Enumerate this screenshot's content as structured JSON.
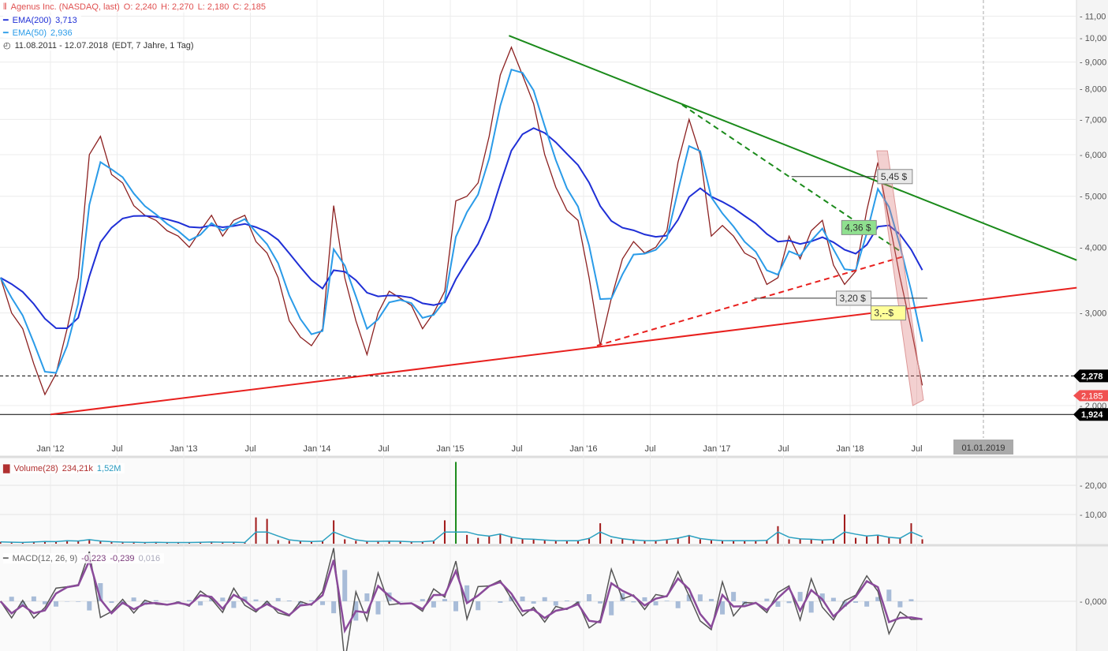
{
  "header": {
    "instrument": "Agenus Inc. (NASDAQ, last)",
    "ohlc": {
      "open": "O: 2,240",
      "high": "H: 2,270",
      "low": "L: 2,180",
      "close": "C: 2,185"
    },
    "ema200": {
      "label": "EMA(200)",
      "value": "3,713",
      "color": "#1f2fd6"
    },
    "ema50": {
      "label": "EMA(50)",
      "value": "2,936",
      "color": "#2a9be8"
    },
    "range": "11.08.2011 - 12.07.2018",
    "range_info": "(EDT, 7 Jahre, 1 Tag)"
  },
  "volume_legend": {
    "label": "Volume(28)",
    "value": "234,21k",
    "avg": "1,52M"
  },
  "macd_legend": {
    "label": "MACD(12, 26, 9)",
    "macd": "-0,223",
    "signal": "-0,239",
    "hist": "0,016"
  },
  "chart_data": {
    "type": "line",
    "scale": "log",
    "grid": true,
    "price_ticks": [
      "11,00",
      "10,00",
      "9,000",
      "8,000",
      "7,000",
      "6,000",
      "5,000",
      "4,000",
      "3,000",
      "2,000"
    ],
    "price_tick_values": [
      11,
      10,
      9,
      8,
      7,
      6,
      5,
      4,
      3,
      2
    ],
    "x_ticks": [
      {
        "label": "Jan '12",
        "date": 2012.0
      },
      {
        "label": "Jul",
        "date": 2012.5
      },
      {
        "label": "Jan '13",
        "date": 2013.0
      },
      {
        "label": "Jul",
        "date": 2013.5
      },
      {
        "label": "Jan '14",
        "date": 2014.0
      },
      {
        "label": "Jul",
        "date": 2014.5
      },
      {
        "label": "Jan '15",
        "date": 2015.0
      },
      {
        "label": "Jul",
        "date": 2015.5
      },
      {
        "label": "Jan '16",
        "date": 2016.0
      },
      {
        "label": "Jul",
        "date": 2016.5
      },
      {
        "label": "Jan '17",
        "date": 2017.0
      },
      {
        "label": "Jul",
        "date": 2017.5
      },
      {
        "label": "Jan '18",
        "date": 2018.0
      },
      {
        "label": "Jul",
        "date": 2018.5
      }
    ],
    "cursor_date": {
      "label": "01.01.2019",
      "date": 2019.0
    },
    "price": {
      "start": "2011-08",
      "values": [
        3.5,
        3.0,
        2.8,
        2.4,
        2.1,
        2.3,
        2.8,
        3.5,
        6.0,
        6.5,
        5.5,
        5.3,
        4.8,
        4.6,
        4.5,
        4.3,
        4.2,
        4.0,
        4.3,
        4.6,
        4.2,
        4.5,
        4.6,
        4.1,
        3.9,
        3.5,
        2.9,
        2.7,
        2.6,
        2.8,
        4.8,
        3.5,
        2.9,
        2.5,
        3.0,
        3.3,
        3.2,
        3.1,
        2.8,
        3.0,
        3.3,
        4.9,
        5.0,
        5.3,
        6.5,
        8.5,
        9.6,
        8.5,
        7.5,
        6.0,
        5.2,
        4.7,
        4.5,
        3.5,
        2.6,
        3.2,
        3.8,
        4.1,
        3.9,
        4.0,
        4.3,
        5.8,
        7.0,
        6.0,
        4.2,
        4.4,
        4.2,
        3.9,
        3.8,
        3.4,
        3.5,
        4.2,
        3.8,
        4.3,
        4.5,
        3.7,
        3.4,
        3.6,
        4.7,
        5.8,
        4.5,
        3.5,
        2.8,
        2.185
      ]
    },
    "trendlines": [
      {
        "color": "#1a8a1a",
        "style": "solid",
        "from": [
          2015.44,
          10.1
        ],
        "to": [
          2019.7,
          3.78
        ]
      },
      {
        "color": "#1a8a1a",
        "style": "dashed",
        "from": [
          2016.74,
          7.46
        ],
        "to": [
          2018.37,
          3.94
        ]
      },
      {
        "color": "#e8201e",
        "style": "solid",
        "from": [
          2012.0,
          1.924
        ],
        "to": [
          2019.7,
          3.35
        ]
      },
      {
        "color": "#e8201e",
        "style": "dashed",
        "from": [
          2016.1,
          2.6
        ],
        "to": [
          2018.4,
          3.84
        ]
      }
    ],
    "horizontal_levels": [
      {
        "value": 2.278,
        "label": "2,278",
        "style": "dashed"
      },
      {
        "value": 1.924,
        "label": "1,924",
        "style": "solid"
      }
    ],
    "last_price": {
      "value": 2.185,
      "label": "2,185",
      "color": "#f05050"
    },
    "annotations": [
      {
        "label": "5,45 $",
        "date": 2018.23,
        "value": 5.45,
        "bg": "#e8e8e8",
        "from": 2017.56,
        "to": 2018.2
      },
      {
        "label": "4,36 $",
        "date": 2017.96,
        "value": 4.36,
        "bg": "#8fe08f"
      },
      {
        "label": "3,20 $",
        "date": 2017.92,
        "value": 3.2,
        "bg": "#e8e8e8",
        "from": 2017.28,
        "to": 2018.58
      },
      {
        "label": "3,--$",
        "date": 2018.18,
        "value": 3.0,
        "bg": "#ffff99"
      }
    ],
    "volume": {
      "ticks": [
        "20,00",
        "10,00"
      ],
      "tick_values": [
        20,
        10
      ],
      "start": "2011-08",
      "values": [
        0.6,
        0.5,
        0.4,
        0.6,
        0.8,
        0.7,
        1.1,
        0.9,
        1.5,
        0.8,
        0.6,
        0.5,
        0.5,
        0.4,
        0.5,
        0.4,
        0.4,
        0.4,
        0.5,
        0.6,
        0.5,
        0.5,
        0.4,
        9,
        8.5,
        1.2,
        1.0,
        0.8,
        0.7,
        0.9,
        8.0,
        1.5,
        1.0,
        0.7,
        0.8,
        0.9,
        0.8,
        0.6,
        0.7,
        1.0,
        8.0,
        28,
        3.0,
        2.0,
        2.5,
        3.5,
        2.0,
        1.5,
        1.5,
        1.2,
        1.0,
        1.0,
        1.0,
        2.0,
        7.0,
        1.5,
        1.5,
        1.2,
        1.0,
        1.0,
        1.5,
        2.0,
        3.0,
        1.5,
        1.2,
        1.0,
        1.0,
        1.0,
        1.0,
        1.2,
        6.0,
        1.5,
        1.5,
        1.5,
        1.2,
        1.5,
        10,
        2.0,
        2.5,
        3.0,
        2.0,
        1.8,
        7.0,
        1.5
      ]
    },
    "macd": {
      "ticks": [
        "0,000"
      ],
      "tick_values": [
        0
      ]
    }
  }
}
